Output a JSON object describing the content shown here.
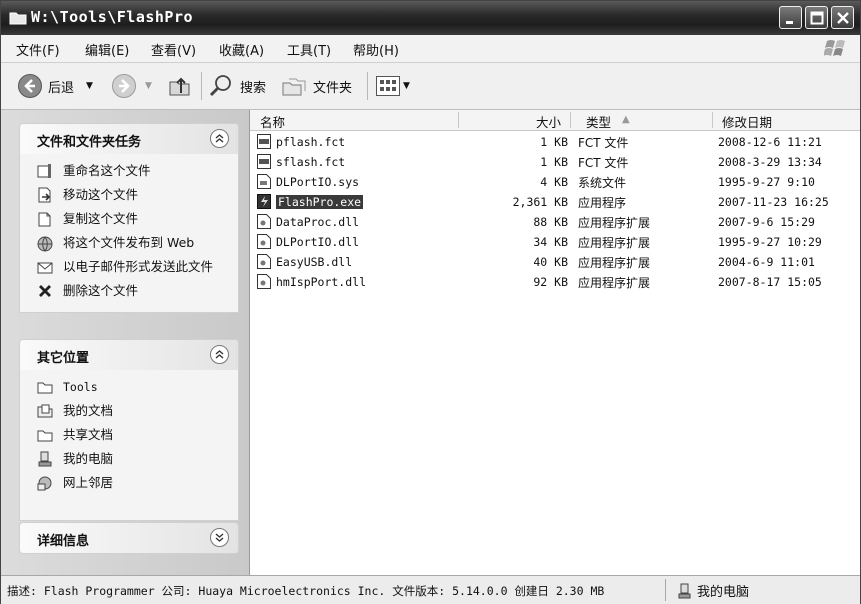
{
  "window": {
    "title": "W:\\Tools\\FlashPro"
  },
  "menu": [
    "文件(F)",
    "编辑(E)",
    "查看(V)",
    "收藏(A)",
    "工具(T)",
    "帮助(H)"
  ],
  "toolbar": {
    "back_label": "后退",
    "search_label": "搜索",
    "folders_label": "文件夹"
  },
  "tasks": {
    "title": "文件和文件夹任务",
    "items": [
      "重命名这个文件",
      "移动这个文件",
      "复制这个文件",
      "将这个文件发布到 Web",
      "以电子邮件形式发送此文件",
      "删除这个文件"
    ]
  },
  "places": {
    "title": "其它位置",
    "items": [
      "Tools",
      "我的文档",
      "共享文档",
      "我的电脑",
      "网上邻居"
    ]
  },
  "details": {
    "title": "详细信息"
  },
  "columns": {
    "name": "名称",
    "size": "大小",
    "type": "类型",
    "date": "修改日期"
  },
  "files": [
    {
      "name": "pflash.fct",
      "size": "1 KB",
      "type": "FCT 文件",
      "date": "2008-12-6 11:21",
      "icon": "fct-file-icon"
    },
    {
      "name": "sflash.fct",
      "size": "1 KB",
      "type": "FCT 文件",
      "date": "2008-3-29 13:34",
      "icon": "fct-file-icon"
    },
    {
      "name": "DLPortIO.sys",
      "size": "4 KB",
      "type": "系统文件",
      "date": "1995-9-27 9:10",
      "icon": "sys-file-icon"
    },
    {
      "name": "FlashPro.exe",
      "size": "2,361 KB",
      "type": "应用程序",
      "date": "2007-11-23 16:25",
      "icon": "exe-file-icon",
      "selected": true
    },
    {
      "name": "DataProc.dll",
      "size": "88 KB",
      "type": "应用程序扩展",
      "date": "2007-9-6 15:29",
      "icon": "dll-file-icon"
    },
    {
      "name": "DLPortIO.dll",
      "size": "34 KB",
      "type": "应用程序扩展",
      "date": "1995-9-27 10:29",
      "icon": "dll-file-icon"
    },
    {
      "name": "EasyUSB.dll",
      "size": "40 KB",
      "type": "应用程序扩展",
      "date": "2004-6-9 11:01",
      "icon": "dll-file-icon"
    },
    {
      "name": "hmIspPort.dll",
      "size": "92 KB",
      "type": "应用程序扩展",
      "date": "2007-8-17 15:05",
      "icon": "dll-file-icon"
    }
  ],
  "status": {
    "description": "描述: Flash Programmer 公司: Huaya Microelectronics Inc. 文件版本: 5.14.0.0 创建日 2.30 MB",
    "zone": "我的电脑"
  }
}
